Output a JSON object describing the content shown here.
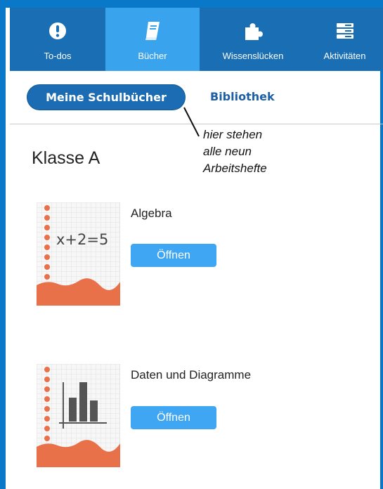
{
  "nav": {
    "items": [
      {
        "label": "To-dos",
        "icon": "exclamation-icon"
      },
      {
        "label": "Bücher",
        "icon": "book-icon"
      },
      {
        "label": "Wissenslücken",
        "icon": "puzzle-icon"
      },
      {
        "label": "Aktivitäten",
        "icon": "list-icon"
      }
    ],
    "active": "Bücher"
  },
  "tabs": {
    "active": "Meine Schulbücher",
    "other": "Bibliothek"
  },
  "annotation": "hier stehen\nalle neun\nArbeitshefte",
  "class_title": "Klasse A",
  "books": [
    {
      "title": "Algebra",
      "cover_text": "x+2=5",
      "button": "Öffnen"
    },
    {
      "title": "Daten und Diagramme",
      "cover_icon": "bar-chart-icon",
      "button": "Öffnen"
    }
  ],
  "colors": {
    "frame": "#0a78c8",
    "nav": "#1a6fb4",
    "nav_active": "#3aa3ee",
    "button": "#3ea6f2",
    "cover_accent": "#e8714a"
  }
}
